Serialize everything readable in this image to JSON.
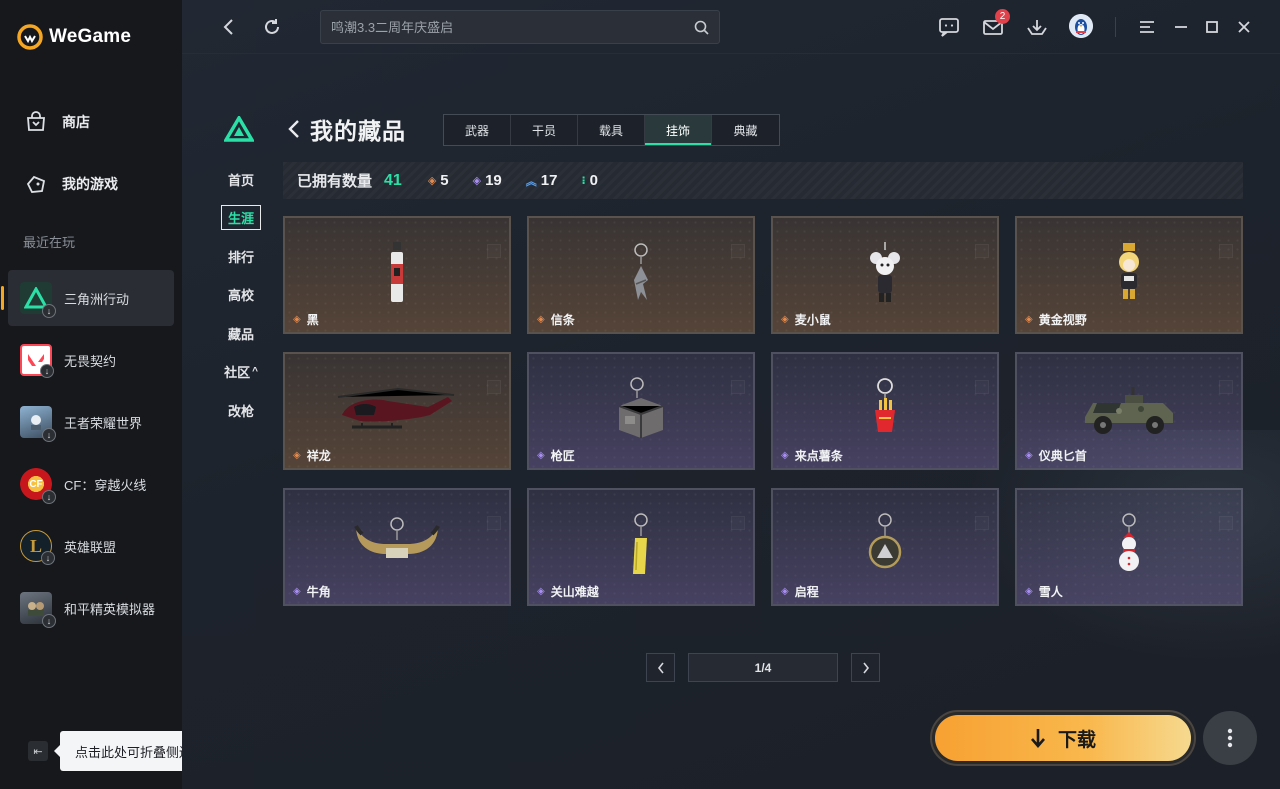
{
  "app": {
    "name": "WeGame"
  },
  "sidebar": {
    "nav": [
      {
        "label": "商店",
        "icon": "store-bag-icon"
      },
      {
        "label": "我的游戏",
        "icon": "gamepad-icon"
      }
    ],
    "recent_label": "最近在玩",
    "recent_games": [
      {
        "label": "三角洲行动",
        "icon": "delta-force-icon",
        "active": true
      },
      {
        "label": "无畏契约",
        "icon": "valorant-icon"
      },
      {
        "label": "王者荣耀世界",
        "icon": "honor-of-kings-world-icon"
      },
      {
        "label": "CF：穿越火线",
        "icon": "crossfire-icon"
      },
      {
        "label": "英雄联盟",
        "icon": "league-of-legends-icon"
      },
      {
        "label": "和平精英模拟器",
        "icon": "peace-elite-icon"
      }
    ],
    "collapse_tooltip": "点击此处可折叠侧边栏"
  },
  "topbar": {
    "search_placeholder": "鸣潮3.3二周年庆盛启",
    "mail_badge": "2"
  },
  "game_nav": {
    "items": [
      "首页",
      "生涯",
      "排行",
      "高校",
      "藏品",
      "社区",
      "改枪"
    ],
    "active": "生涯",
    "community_suffix": "^"
  },
  "collection": {
    "title": "我的藏品",
    "tabs": [
      "武器",
      "干员",
      "载具",
      "挂饰",
      "典藏"
    ],
    "active_tab": "挂饰",
    "owned_label": "已拥有数量",
    "owned_total": "41",
    "rarity_counts": [
      {
        "value": "5",
        "color": "#e38b4f",
        "icon": "diamond-orange-icon"
      },
      {
        "value": "19",
        "color": "#a98ef2",
        "icon": "diamond-purple-icon"
      },
      {
        "value": "17",
        "color": "#5aa0f0",
        "icon": "chevron-blue-icon"
      },
      {
        "value": "0",
        "color": "#2be0a7",
        "icon": "dots-green-icon"
      }
    ],
    "items": [
      {
        "name": "黑",
        "rarity": "orange",
        "art": "pendant-black-tag"
      },
      {
        "name": "信条",
        "rarity": "orange",
        "art": "pendant-creed-blade"
      },
      {
        "name": "麦小鼠",
        "rarity": "orange",
        "art": "pendant-mouse-doll"
      },
      {
        "name": "黄金视野",
        "rarity": "orange",
        "art": "pendant-golden-doll"
      },
      {
        "name": "祥龙",
        "rarity": "orange",
        "art": "helicopter"
      },
      {
        "name": "枪匠",
        "rarity": "purple",
        "art": "pendant-gunsmith-box"
      },
      {
        "name": "来点薯条",
        "rarity": "purple",
        "art": "pendant-fries"
      },
      {
        "name": "仪典匕首",
        "rarity": "purple",
        "art": "armored-vehicle"
      },
      {
        "name": "牛角",
        "rarity": "purple",
        "art": "pendant-horns"
      },
      {
        "name": "关山难越",
        "rarity": "purple",
        "art": "pendant-gold-bar"
      },
      {
        "name": "启程",
        "rarity": "purple",
        "art": "pendant-medal"
      },
      {
        "name": "雪人",
        "rarity": "purple",
        "art": "pendant-snowman"
      }
    ],
    "pager": {
      "current": "1/4"
    }
  },
  "download": {
    "label": "下载"
  },
  "colors": {
    "accent_green": "#2be0a7",
    "download_orange": "#f7a132",
    "active_indicator": "#f5a623"
  }
}
